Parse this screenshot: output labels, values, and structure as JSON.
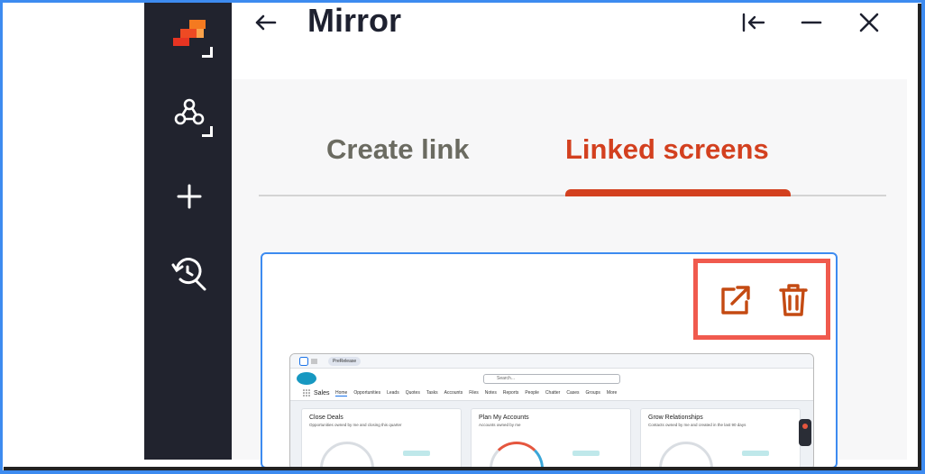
{
  "app": {
    "title": "Mirror",
    "back_icon": "arrow-left-icon",
    "collapse_icon": "collapse-left-icon",
    "minimize_icon": "minimize-icon",
    "close_icon": "close-icon",
    "accent": "#d3401f",
    "rail_color": "#21232e"
  },
  "rail": {
    "items": [
      {
        "name": "logo",
        "icon": "stacked-squares-logo-icon"
      },
      {
        "name": "connections",
        "icon": "network-nodes-icon"
      },
      {
        "name": "add",
        "icon": "plus-icon"
      },
      {
        "name": "history-search",
        "icon": "history-search-icon"
      }
    ]
  },
  "tabs": [
    {
      "label": "Create link",
      "active": false
    },
    {
      "label": "Linked screens",
      "active": true
    }
  ],
  "card": {
    "open_icon": "open-external-icon",
    "delete_icon": "trash-icon",
    "thumbnail": {
      "badge": "PreRelease",
      "search_placeholder": "Search...",
      "app_name": "Sales",
      "nav": [
        "Home",
        "Opportunities",
        "Leads",
        "Quotes",
        "Tasks",
        "Accounts",
        "Files",
        "Notes",
        "Reports",
        "People",
        "Chatter",
        "Cases",
        "Groups",
        "More"
      ],
      "panels": [
        {
          "title": "Close Deals",
          "subtitle": "Opportunities owned by me and closing this quarter"
        },
        {
          "title": "Plan My Accounts",
          "subtitle": "Accounts owned by me"
        },
        {
          "title": "Grow Relationships",
          "subtitle": "Contacts owned by me and created in the last 90 days"
        }
      ]
    }
  }
}
